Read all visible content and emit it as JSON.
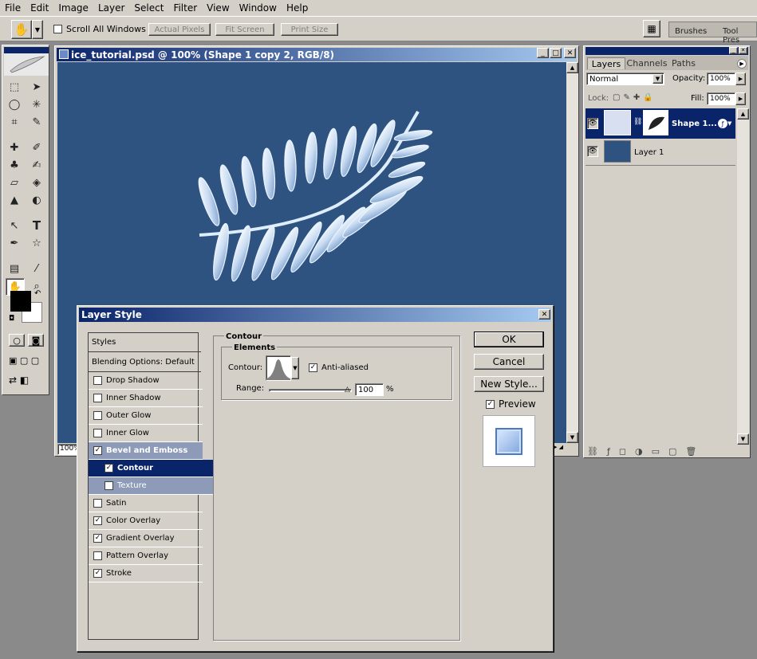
{
  "menu": [
    "File",
    "Edit",
    "Image",
    "Layer",
    "Select",
    "Filter",
    "View",
    "Window",
    "Help"
  ],
  "options": {
    "scroll_all": "Scroll All Windows",
    "actual_pixels": "Actual Pixels",
    "fit_screen": "Fit Screen",
    "print_size": "Print Size",
    "brushes_tab": "Brushes",
    "tool_presets_tab": "Tool Pres"
  },
  "document": {
    "title": "ice_tutorial.psd @ 100% (Shape 1 copy 2, RGB/8)",
    "zoom": "100%",
    "bg_color": "#2e5380"
  },
  "layers_panel": {
    "tabs": [
      "Layers",
      "Channels",
      "Paths"
    ],
    "blend_mode": "Normal",
    "opacity_label": "Opacity:",
    "opacity": "100%",
    "lock_label": "Lock:",
    "fill_label": "Fill:",
    "fill": "100%",
    "layers": [
      {
        "name": "Shape 1...",
        "selected": true
      },
      {
        "name": "Layer 1",
        "selected": false
      }
    ]
  },
  "dialog": {
    "title": "Layer Style",
    "styles_header": "Styles",
    "blending": "Blending Options: Default",
    "items": [
      {
        "label": "Drop Shadow",
        "checked": false
      },
      {
        "label": "Inner Shadow",
        "checked": false
      },
      {
        "label": "Outer Glow",
        "checked": false
      },
      {
        "label": "Inner Glow",
        "checked": false
      },
      {
        "label": "Bevel and Emboss",
        "checked": true
      },
      {
        "label": "Contour",
        "checked": true
      },
      {
        "label": "Texture",
        "checked": false
      },
      {
        "label": "Satin",
        "checked": false
      },
      {
        "label": "Color Overlay",
        "checked": true
      },
      {
        "label": "Gradient Overlay",
        "checked": true
      },
      {
        "label": "Pattern Overlay",
        "checked": false
      },
      {
        "label": "Stroke",
        "checked": true
      }
    ],
    "section_title": "Contour",
    "group_title": "Elements",
    "contour_label": "Contour:",
    "anti_aliased": "Anti-aliased",
    "range_label": "Range:",
    "range_value": "100",
    "range_unit": "%",
    "ok": "OK",
    "cancel": "Cancel",
    "new_style": "New Style...",
    "preview": "Preview"
  }
}
